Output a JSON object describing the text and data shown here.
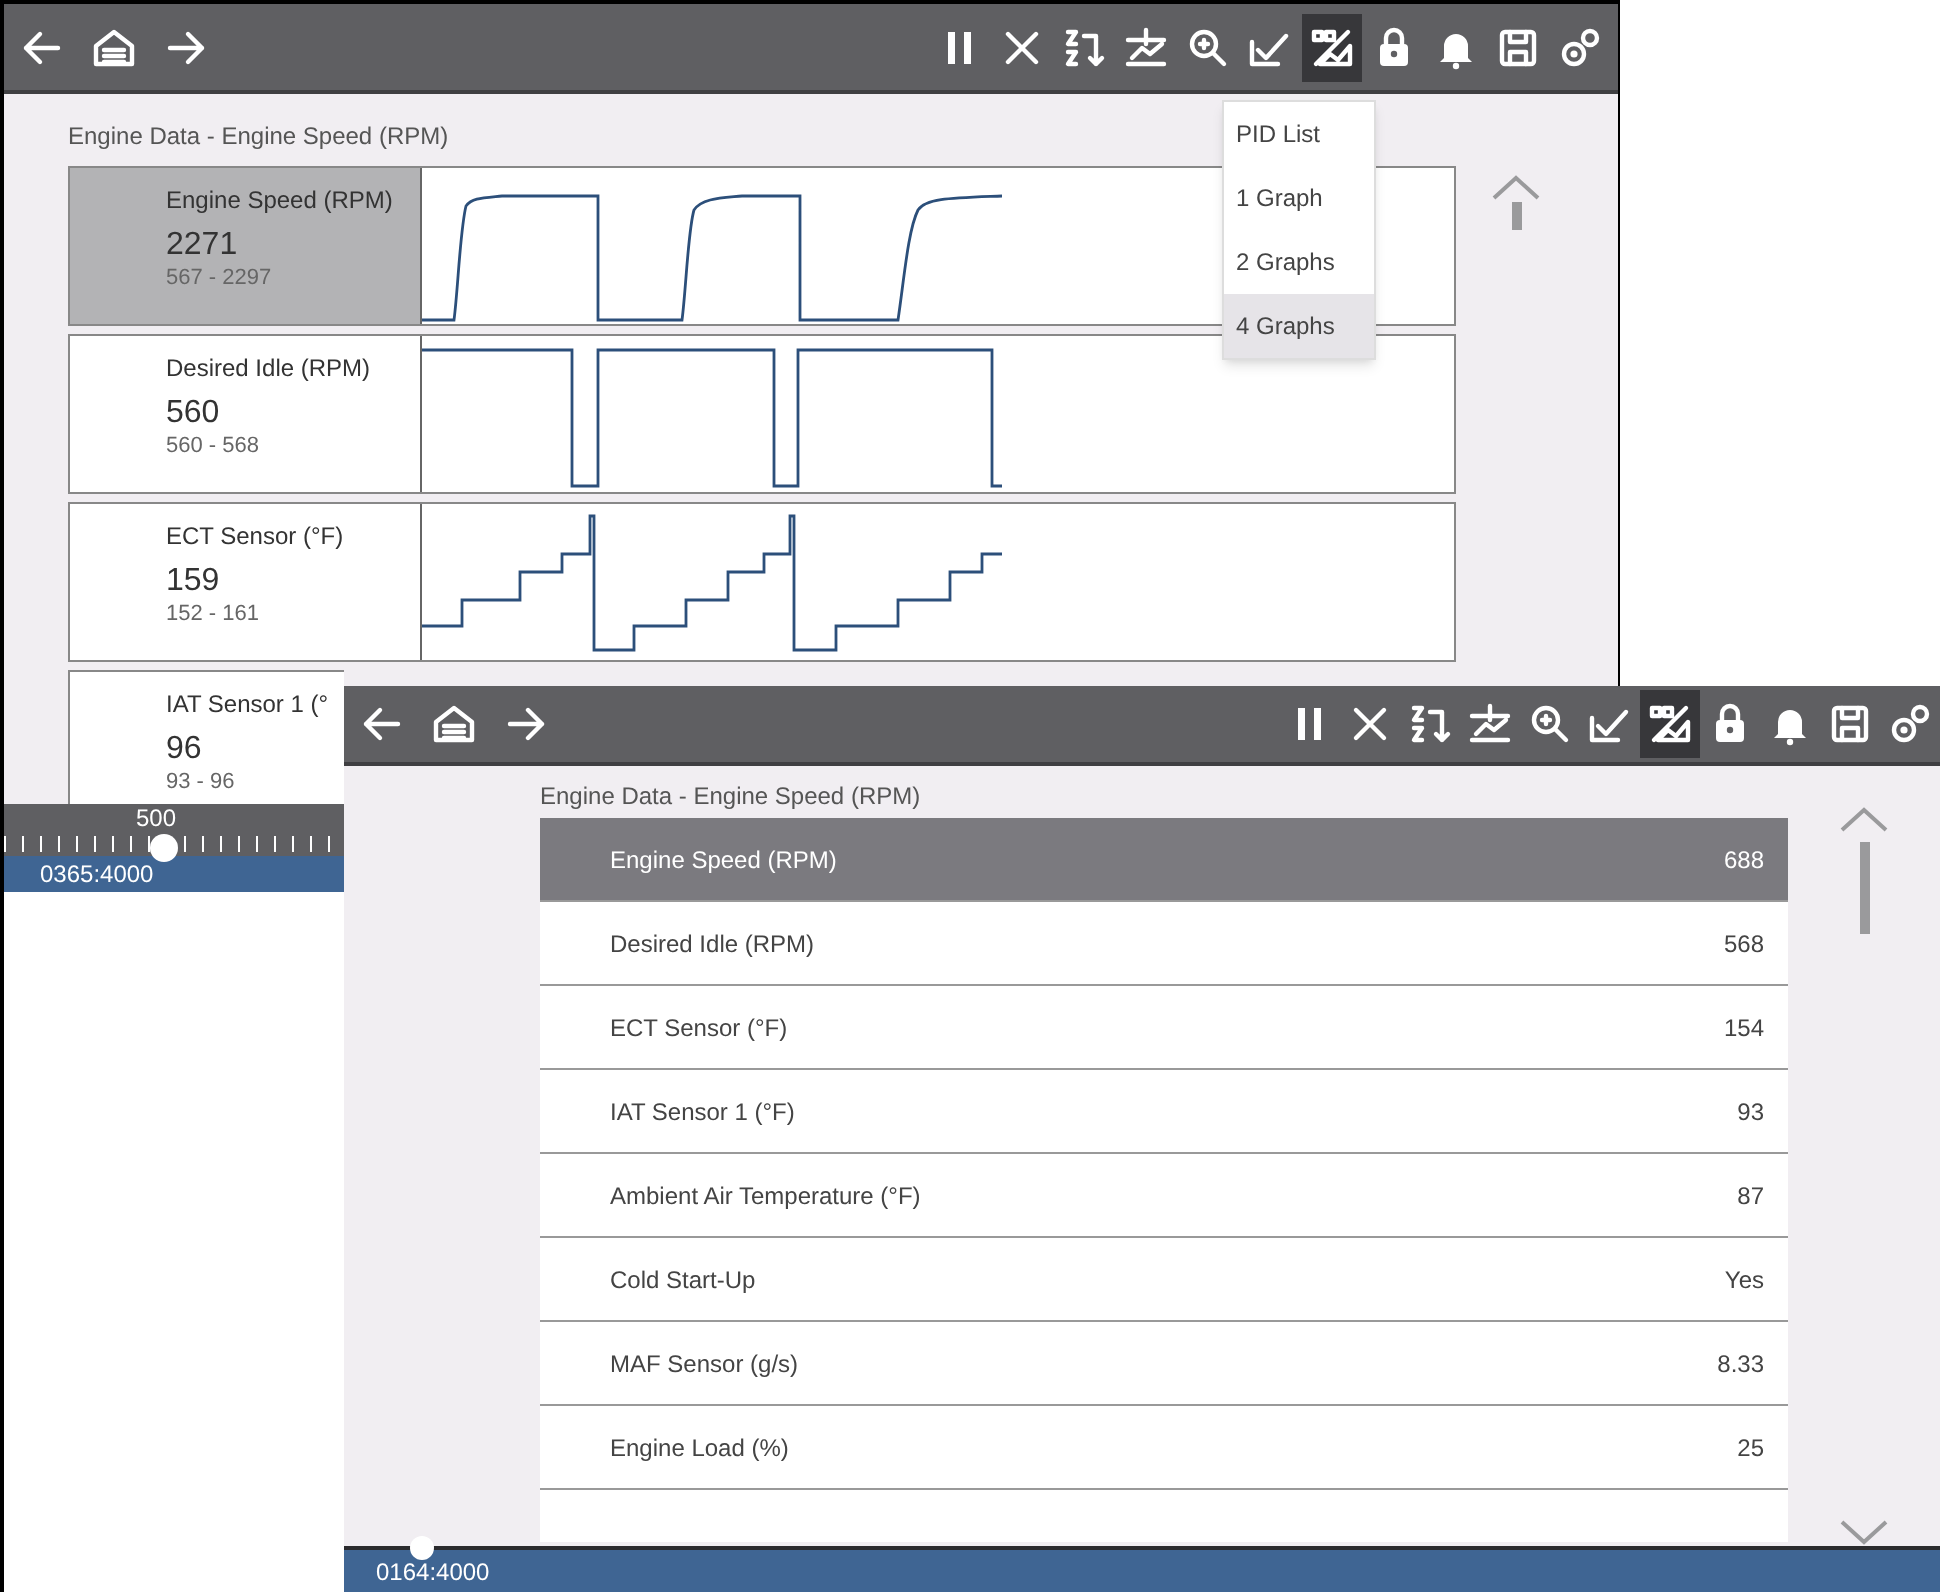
{
  "graph_window": {
    "toolbar": {
      "buttons": [
        {
          "selected": false
        },
        {
          "selected": false
        },
        {
          "selected": false
        },
        {
          "selected": false
        },
        {
          "selected": false
        },
        {
          "selected": false
        },
        {
          "selected": false
        },
        {
          "selected": false
        },
        {
          "selected": false
        },
        {
          "selected": true
        },
        {
          "selected": false
        },
        {
          "selected": false
        },
        {
          "selected": false
        },
        {
          "selected": false
        }
      ]
    },
    "title": "Engine Data - Engine Speed (RPM)",
    "view_menu": [
      {
        "label": "PID List",
        "selected": false
      },
      {
        "label": "1 Graph",
        "selected": false
      },
      {
        "label": "2 Graphs",
        "selected": false
      },
      {
        "label": "4 Graphs",
        "selected": true
      }
    ],
    "graphs": [
      {
        "label": "Engine Speed (RPM)",
        "value": "2271",
        "range": "567 - 2297",
        "selected": true,
        "kind": "ramp"
      },
      {
        "label": "Desired Idle (RPM)",
        "value": "560",
        "range": "560 - 568",
        "selected": false,
        "kind": "dip"
      },
      {
        "label": "ECT Sensor (°F)",
        "value": "159",
        "range": "152 - 161",
        "selected": false,
        "kind": "steps"
      },
      {
        "label": "IAT Sensor 1 (°",
        "value": "96",
        "range": "93 - 96",
        "selected": false,
        "kind": "hidden"
      }
    ],
    "ruler_label": "500",
    "position": "0365:4000"
  },
  "list_window": {
    "toolbar": {
      "buttons": [
        {
          "selected": false
        },
        {
          "selected": false
        },
        {
          "selected": false
        },
        {
          "selected": false
        },
        {
          "selected": false
        },
        {
          "selected": false
        },
        {
          "selected": false
        },
        {
          "selected": false
        },
        {
          "selected": false
        },
        {
          "selected": true
        },
        {
          "selected": false
        },
        {
          "selected": false
        },
        {
          "selected": false
        },
        {
          "selected": false
        }
      ]
    },
    "title": "Engine Data - Engine Speed (RPM)",
    "rows": [
      {
        "name": "Engine Speed (RPM)",
        "value": "688",
        "selected": true
      },
      {
        "name": "Desired Idle (RPM)",
        "value": "568",
        "selected": false
      },
      {
        "name": "ECT Sensor (°F)",
        "value": "154",
        "selected": false
      },
      {
        "name": "IAT Sensor 1 (°F)",
        "value": "93",
        "selected": false
      },
      {
        "name": "Ambient Air Temperature (°F)",
        "value": "87",
        "selected": false
      },
      {
        "name": "Cold Start-Up",
        "value": "Yes",
        "selected": false
      },
      {
        "name": "MAF Sensor (g/s)",
        "value": "8.33",
        "selected": false
      },
      {
        "name": "Engine Load (%)",
        "value": "25",
        "selected": false
      }
    ],
    "position": "0164:4000"
  }
}
